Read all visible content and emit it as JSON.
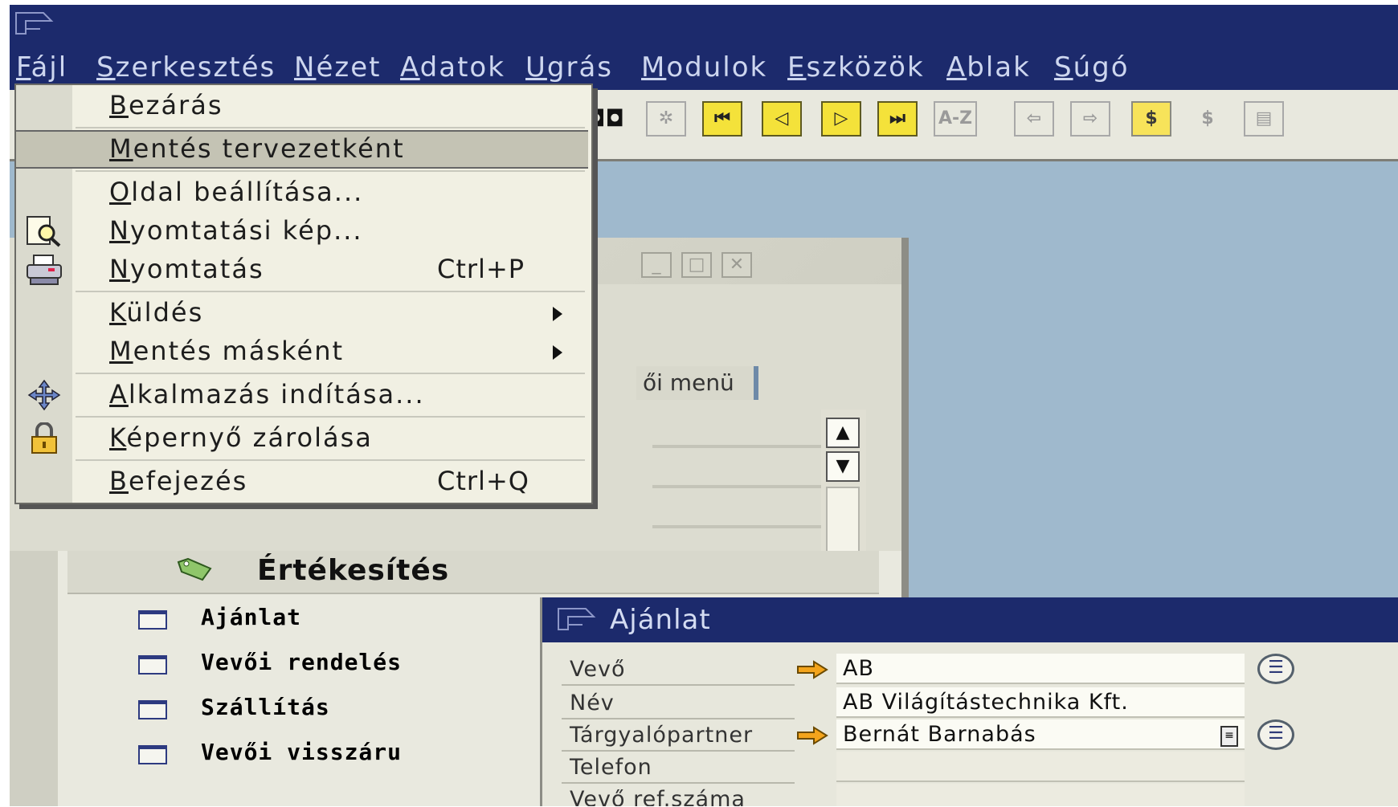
{
  "menubar": {
    "items": [
      "Fájl",
      "Szerkesztés",
      "Nézet",
      "Adatok",
      "Ugrás",
      "Modulok",
      "Eszközök",
      "Ablak",
      "Súgó"
    ]
  },
  "file_menu": {
    "items": [
      {
        "label": "Bezárás",
        "shortcut": ""
      },
      {
        "label": "Mentés tervezetként",
        "shortcut": ""
      },
      {
        "label": "Oldal beállítása...",
        "shortcut": ""
      },
      {
        "label": "Nyomtatási kép...",
        "shortcut": ""
      },
      {
        "label": "Nyomtatás",
        "shortcut": "Ctrl+P"
      },
      {
        "label": "Küldés",
        "shortcut": ""
      },
      {
        "label": "Mentés másként",
        "shortcut": ""
      },
      {
        "label": "Alkalmazás indítása...",
        "shortcut": ""
      },
      {
        "label": "Képernyő zárolása",
        "shortcut": ""
      },
      {
        "label": "Befejezés",
        "shortcut": "Ctrl+Q"
      }
    ],
    "highlighted": "Mentés tervezetként"
  },
  "main_menu_window": {
    "tab_label": "ői menü",
    "section_label": "Értékesítés",
    "items": [
      "Ajánlat",
      "Vevői rendelés",
      "Szállítás",
      "Vevői visszáru"
    ]
  },
  "quote_window": {
    "title": "Ajánlat",
    "fields": [
      {
        "label": "Vevő",
        "value": "AB"
      },
      {
        "label": "Név",
        "value": "AB Világítástechnika Kft."
      },
      {
        "label": "Tárgyalópartner",
        "value": "Bernát Barnabás"
      },
      {
        "label": "Telefon",
        "value": ""
      },
      {
        "label": "Vevő ref.száma",
        "value": ""
      }
    ]
  },
  "colors": {
    "titlebar": "#1c2a6c",
    "desktop": "#9fb9cd",
    "menu_bg": "#f1f0e3",
    "highlight": "#c4c3b4"
  }
}
